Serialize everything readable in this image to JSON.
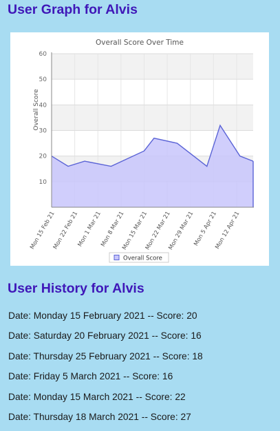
{
  "graph_heading": "User Graph for Alvis",
  "history_heading": "User History for Alvis",
  "chart_data": {
    "type": "area",
    "title": "Overall Score Over Time",
    "xlabel": "",
    "ylabel": "Overall Score",
    "ylim": [
      0,
      60
    ],
    "yticks": [
      10,
      20,
      30,
      40,
      50,
      60
    ],
    "grid": true,
    "legend": "bottom-center",
    "x_range": [
      "2021-02-15",
      "2021-04-17"
    ],
    "xticks": [
      {
        "date": "2021-02-15",
        "label": "Mon 15 Feb 21"
      },
      {
        "date": "2021-02-22",
        "label": "Mon 22 Feb 21"
      },
      {
        "date": "2021-03-01",
        "label": "Mon 1 Mar 21"
      },
      {
        "date": "2021-03-08",
        "label": "Mon 8 Mar 21"
      },
      {
        "date": "2021-03-15",
        "label": "Mon 15 Mar 21"
      },
      {
        "date": "2021-03-22",
        "label": "Mon 22 Mar 21"
      },
      {
        "date": "2021-03-29",
        "label": "Mon 29 Mar 21"
      },
      {
        "date": "2021-04-05",
        "label": "Mon 5 Apr 21"
      },
      {
        "date": "2021-04-12",
        "label": "Mon 12 Apr 21"
      }
    ],
    "series": [
      {
        "name": "Overall Score",
        "color": "#5a63d6",
        "fill": "#c8c6fb",
        "points": [
          {
            "date": "2021-02-15",
            "value": 20
          },
          {
            "date": "2021-02-20",
            "value": 16
          },
          {
            "date": "2021-02-25",
            "value": 18
          },
          {
            "date": "2021-03-05",
            "value": 16
          },
          {
            "date": "2021-03-15",
            "value": 22
          },
          {
            "date": "2021-03-18",
            "value": 27
          },
          {
            "date": "2021-03-25",
            "value": 25
          },
          {
            "date": "2021-04-03",
            "value": 16
          },
          {
            "date": "2021-04-07",
            "value": 32
          },
          {
            "date": "2021-04-13",
            "value": 20
          },
          {
            "date": "2021-04-17",
            "value": 18
          }
        ]
      }
    ]
  },
  "history": [
    "Date: Monday 15 February 2021 -- Score: 20",
    "Date: Saturday 20 February 2021 -- Score: 16",
    "Date: Thursday 25 February 2021 -- Score: 18",
    "Date: Friday 5 March 2021 -- Score: 16",
    "Date: Monday 15 March 2021 -- Score: 22",
    "Date: Thursday 18 March 2021 -- Score: 27"
  ]
}
